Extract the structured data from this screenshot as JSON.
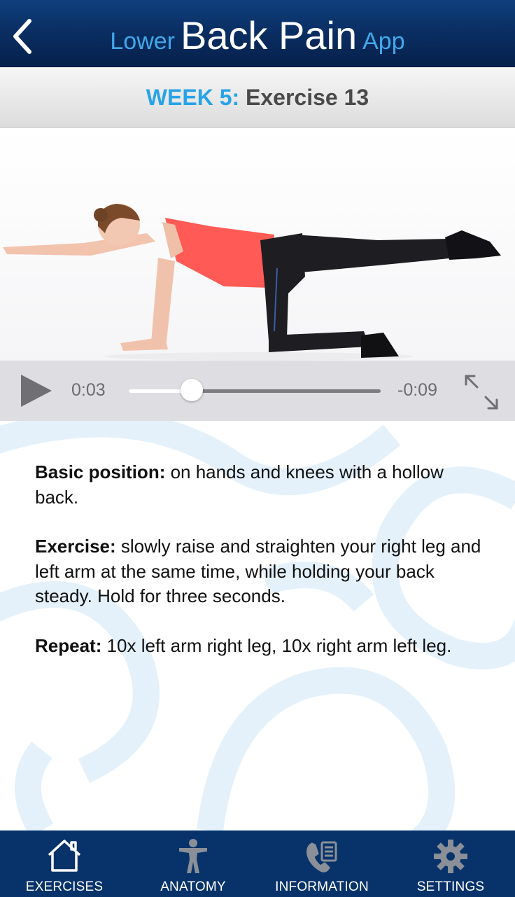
{
  "header": {
    "title_prefix": "Lower",
    "title_main": "Back Pain",
    "title_suffix": "App",
    "background_color": "#0a2f64",
    "accent_color": "#42a8ea"
  },
  "subheader": {
    "week_label": "WEEK 5:",
    "exercise_label": "Exercise 13"
  },
  "player": {
    "current_time": "0:03",
    "remaining_time": "-0:09",
    "progress": 0.25
  },
  "description": {
    "basic_label": "Basic position:",
    "basic_text": " on hands and knees with a hollow back.",
    "exercise_label": "Exercise:",
    "exercise_text": " slowly raise and straighten your right leg and left arm at the same time, while holding your back steady. Hold for three seconds.",
    "repeat_label": "Repeat:",
    "repeat_text": " 10x left arm right leg, 10x right arm left leg."
  },
  "tabs": [
    {
      "label": "EXERCISES",
      "icon": "home-icon"
    },
    {
      "label": "ANATOMY",
      "icon": "person-icon"
    },
    {
      "label": "INFORMATION",
      "icon": "phone-list-icon"
    },
    {
      "label": "SETTINGS",
      "icon": "gear-icon"
    }
  ]
}
